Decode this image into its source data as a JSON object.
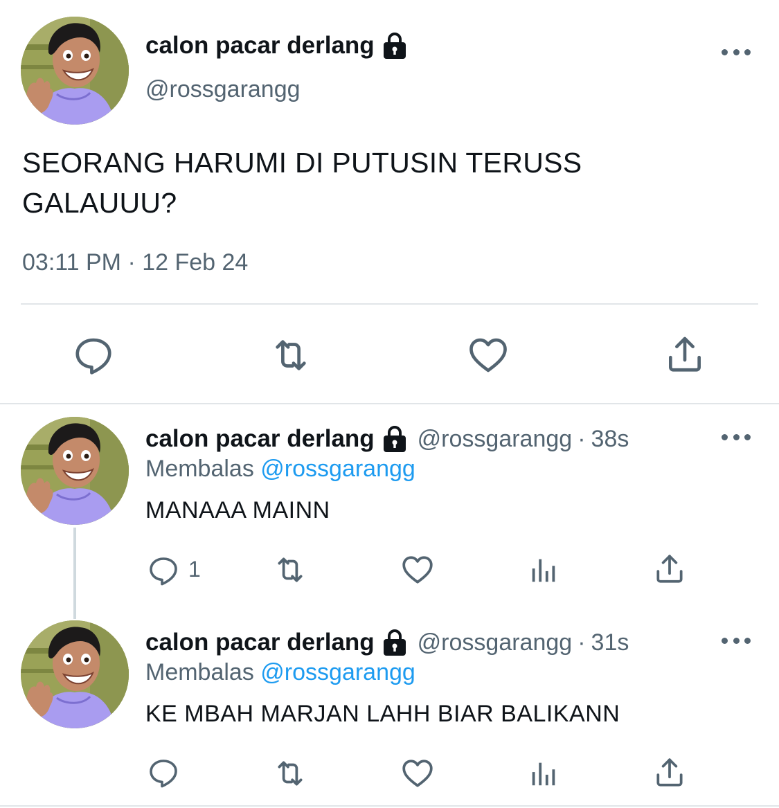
{
  "main_tweet": {
    "display_name": "calon pacar derlang",
    "handle": "@rossgarangg",
    "text_line1": "SEORANG HARUMI DI PUTUSIN TERUSS",
    "text_line2": "GALAUUU?",
    "timestamp": "03:11 PM · 12 Feb 24",
    "icons": [
      "reply-icon",
      "retweet-icon",
      "like-icon",
      "share-icon"
    ]
  },
  "replies": [
    {
      "display_name": "calon pacar derlang",
      "handle": "@rossgarangg",
      "separator": "·",
      "time": "38s",
      "replying_label": "Membalas",
      "replying_to": "@rossgarangg",
      "text": "MANAAA MAINN",
      "reply_count": "1"
    },
    {
      "display_name": "calon pacar derlang",
      "handle": "@rossgarangg",
      "separator": "·",
      "time": "31s",
      "replying_label": "Membalas",
      "replying_to": "@rossgarangg",
      "text": "KE MBAH MARJAN LAHH BIAR BALIKANN",
      "reply_count": ""
    }
  ],
  "colors": {
    "text": "#0f1419",
    "secondary": "#536471",
    "mention": "#1d9bf0",
    "divider": "#e1e5e8"
  }
}
